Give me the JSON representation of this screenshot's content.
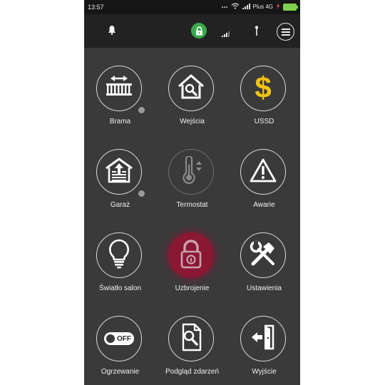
{
  "status_bar": {
    "time": "13:57",
    "network": "Plus 4G",
    "battery_color": "#7fd04e"
  },
  "toolbar": {
    "icons": [
      "bell-icon",
      "lock-icon",
      "signal-icon",
      "antenna-icon",
      "menu-icon"
    ],
    "lock_badge_color": "#3aa84c"
  },
  "tiles": [
    {
      "label": "Brama",
      "icon": "gate-icon",
      "status_dot": true
    },
    {
      "label": "Wejścia",
      "icon": "house-search-icon",
      "status_dot": false
    },
    {
      "label": "USSD",
      "icon": "dollar-icon",
      "status_dot": false
    },
    {
      "label": "Garaż",
      "icon": "garage-icon",
      "status_dot": true
    },
    {
      "label": "Termostat",
      "icon": "thermometer-icon",
      "status_dot": false
    },
    {
      "label": "Awarie",
      "icon": "warning-icon",
      "status_dot": false
    },
    {
      "label": "Światło salon",
      "icon": "bulb-icon",
      "status_dot": false
    },
    {
      "label": "Uzbrojenie",
      "icon": "padlock-icon",
      "status_dot": false
    },
    {
      "label": "Ustawienia",
      "icon": "tools-icon",
      "status_dot": false
    },
    {
      "label": "Ogrzewanie",
      "icon": "toggle-off-icon",
      "status_dot": false,
      "toggle_text": "OFF"
    },
    {
      "label": "Podgląd zdarzeń",
      "icon": "document-search-icon",
      "status_dot": false
    },
    {
      "label": "Wyjście",
      "icon": "exit-door-icon",
      "status_dot": false
    }
  ],
  "colors": {
    "background": "#3a3a3a",
    "toolbar": "#222222",
    "armed": "#8a1733",
    "ussd_gold": "#f2c314"
  }
}
